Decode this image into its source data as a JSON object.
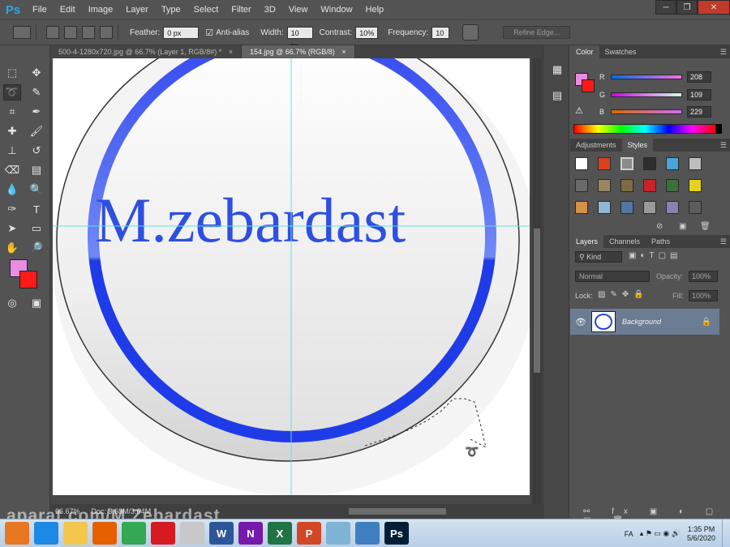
{
  "app": {
    "logo": "Ps"
  },
  "menu": [
    "File",
    "Edit",
    "Image",
    "Layer",
    "Type",
    "Select",
    "Filter",
    "3D",
    "View",
    "Window",
    "Help"
  ],
  "window_controls": {
    "minimize": "─",
    "restore": "❐",
    "close": "✕"
  },
  "options": {
    "feather_label": "Feather:",
    "feather_value": "0 px",
    "antialias_label": "Anti-alias",
    "width_label": "Width:",
    "width_value": "10 px",
    "contrast_label": "Contrast:",
    "contrast_value": "10%",
    "frequency_label": "Frequency:",
    "frequency_value": "10",
    "refine_edge": "Refine Edge..."
  },
  "tabs": [
    {
      "label": "500-4-1280x720.jpg @ 66.7% (Layer 1, RGB/8#) *",
      "close": "×"
    },
    {
      "label": "154.jpg @ 66.7% (RGB/8)",
      "close": "×"
    }
  ],
  "canvas": {
    "text": "M.zebardast",
    "ring_color": "#2741e8",
    "text_color": "#2f4fe0"
  },
  "status": {
    "zoom": "66.67%",
    "doc": "Doc: 3.68M/3.64M"
  },
  "watermark": "aparat.com/M.Zebardast",
  "color_panel": {
    "tabs": [
      "Color",
      "Swatches"
    ],
    "foreground": "#e98de4",
    "background": "#ff1a1a",
    "channels": [
      {
        "label": "R",
        "value": "208"
      },
      {
        "label": "G",
        "value": "109"
      },
      {
        "label": "B",
        "value": "229"
      }
    ]
  },
  "styles_panel": {
    "tabs": [
      "Adjustments",
      "Styles"
    ]
  },
  "layers_panel": {
    "tabs": [
      "Layers",
      "Channels",
      "Paths"
    ],
    "kind": "Kind",
    "blend_mode": "Normal",
    "opacity_label": "Opacity:",
    "opacity_value": "100%",
    "lock_label": "Lock:",
    "fill_label": "Fill:",
    "fill_value": "100%",
    "layers": [
      {
        "name": "Background",
        "visible": true,
        "locked": true
      }
    ]
  },
  "taskbar": {
    "apps": [
      {
        "name": "Media Player",
        "color": "#e87722"
      },
      {
        "name": "Internet Explorer",
        "color": "#1e88e5"
      },
      {
        "name": "File Explorer",
        "color": "#f3c64e"
      },
      {
        "name": "Firefox",
        "color": "#e66000"
      },
      {
        "name": "Chrome",
        "color": "#34a853"
      },
      {
        "name": "Acrobat",
        "color": "#d71920"
      },
      {
        "name": "Paint",
        "color": "#c8c8c8"
      },
      {
        "name": "Word",
        "color": "#2b579a",
        "glyph": "W"
      },
      {
        "name": "OneNote",
        "color": "#7719aa",
        "glyph": "N"
      },
      {
        "name": "Excel",
        "color": "#217346",
        "glyph": "X"
      },
      {
        "name": "PowerPoint",
        "color": "#d24726",
        "glyph": "P"
      },
      {
        "name": "Snipping",
        "color": "#7fb3d5"
      },
      {
        "name": "Remote",
        "color": "#3f7fbf"
      },
      {
        "name": "Photoshop",
        "color": "#001e36",
        "glyph": "Ps"
      }
    ],
    "lang": "FA",
    "time": "1:35 PM",
    "date": "5/6/2020"
  }
}
